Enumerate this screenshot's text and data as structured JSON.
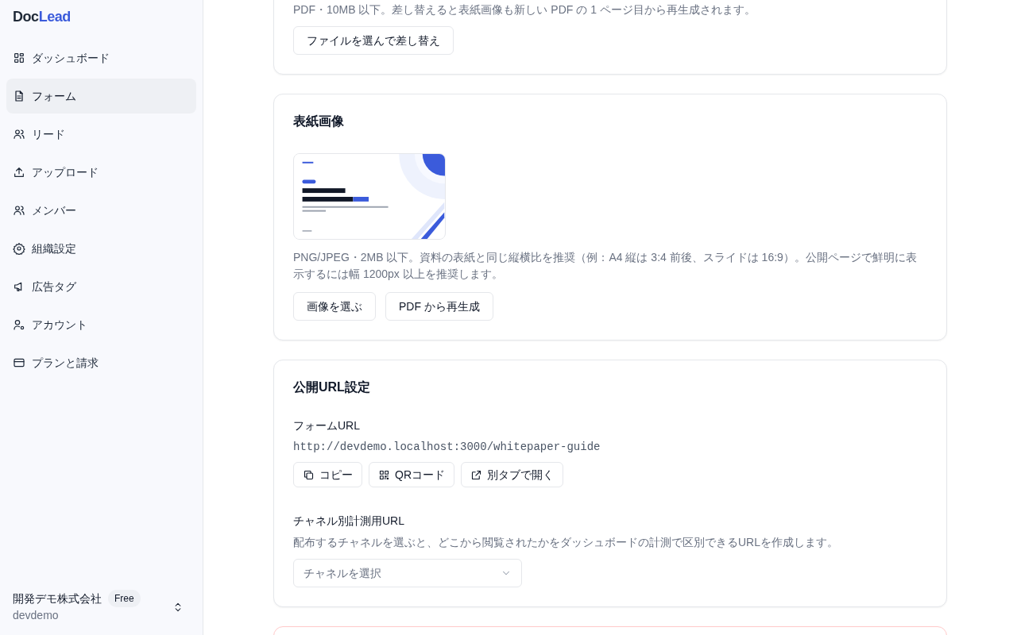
{
  "sidebar": {
    "logo": {
      "part_1": "Doc",
      "part_2": "Lead"
    },
    "items": [
      {
        "label": "ダッシュボード",
        "selected": false
      },
      {
        "label": "フォーム",
        "selected": true
      },
      {
        "label": "リード",
        "selected": false
      },
      {
        "label": "アップロード",
        "selected": false
      },
      {
        "label": "メンバー",
        "selected": false
      },
      {
        "label": "組織設定",
        "selected": false
      },
      {
        "label": "広告タグ",
        "selected": false
      },
      {
        "label": "アカウント",
        "selected": false
      },
      {
        "label": "プランと請求",
        "selected": false
      }
    ],
    "organization": {
      "name": "開発デモ株式会社",
      "plan": "Free",
      "slug": "devdemo"
    }
  },
  "pdf_card": {
    "hint": "PDF・10MB 以下。差し替えると表紙画像も新しい PDF の 1 ページ目から再生成されます。",
    "buttons": [
      "ファイルを選んで差し替え"
    ]
  },
  "cover_card": {
    "title": "表紙画像",
    "image": {
      "kind": "picture"
    },
    "hint": "PNG/JPEG・2MB 以下。資料の表紙と同じ縦横比を推奨（例：A4 縦は 3:4 前後、スライドは 16:9）。公開ページで鮮明に表示するには幅 1200px 以上を推奨します。",
    "buttons": [
      "画像を選ぶ",
      "PDF から再生成"
    ]
  },
  "url_card": {
    "title": "公開URL設定",
    "form_url": {
      "label": "フォームURL",
      "value": "http://devdemo.localhost:3000/whitepaper-guide",
      "buttons": [
        "コピー",
        "QRコード",
        "別タブで開く"
      ]
    },
    "channel_url": {
      "label": "チャネル別計測用URL",
      "hint": "配布するチャネルを選ぶと、どこから閲覧されたかをダッシュボードの計測で区別できるURLを作成します。",
      "select": {
        "placeholder": "チャネルを選択"
      }
    }
  }
}
